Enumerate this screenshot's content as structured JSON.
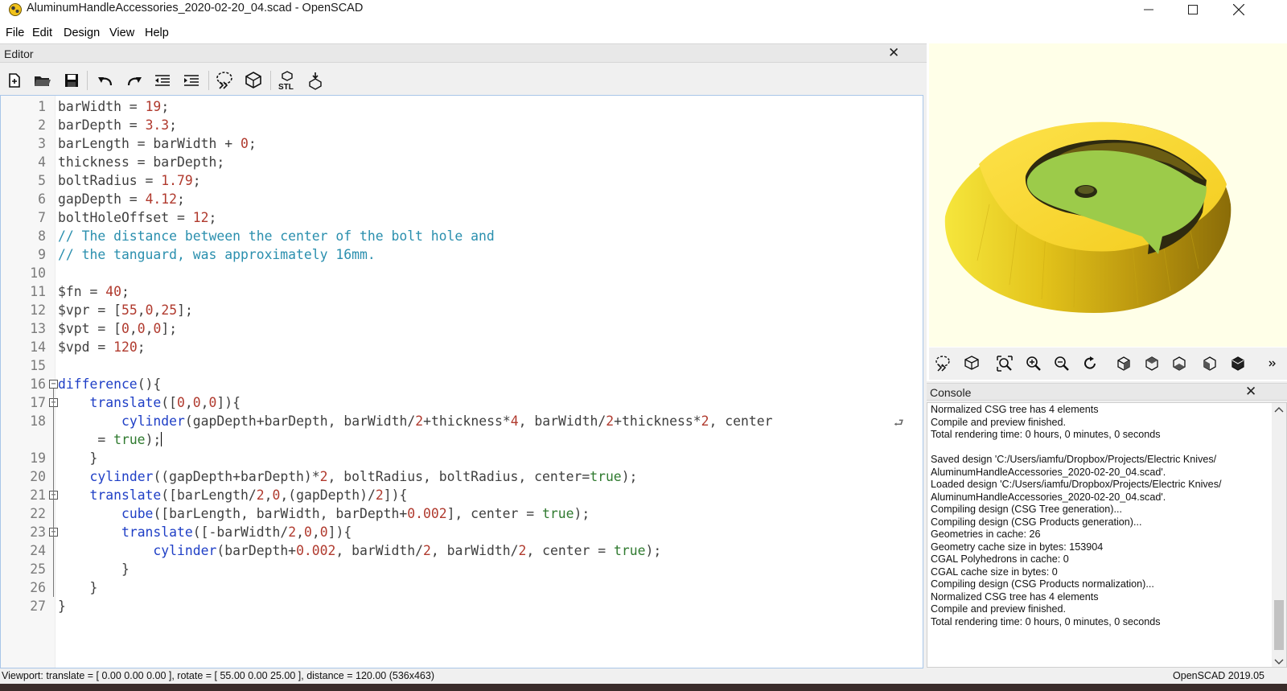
{
  "window": {
    "title": "AluminumHandleAccessories_2020-02-20_04.scad - OpenSCAD"
  },
  "menu": {
    "items": [
      "File",
      "Edit",
      "Design",
      "View",
      "Help"
    ]
  },
  "editor": {
    "title": "Editor",
    "close_label": "✕",
    "toolbar": [
      "new-icon",
      "open-icon",
      "save-icon",
      "undo-icon",
      "redo-icon",
      "unindent-icon",
      "indent-icon",
      "preview-icon",
      "render-icon",
      "export-stl-icon",
      "send-to-print-icon"
    ],
    "lines": [
      {
        "n": "1",
        "text": "barWidth = 19;"
      },
      {
        "n": "2",
        "text": "barDepth = 3.3;"
      },
      {
        "n": "3",
        "text": "barLength = barWidth + 0;"
      },
      {
        "n": "4",
        "text": "thickness = barDepth;"
      },
      {
        "n": "5",
        "text": "boltRadius = 1.79;"
      },
      {
        "n": "6",
        "text": "gapDepth = 4.12;"
      },
      {
        "n": "7",
        "text": "boltHoleOffset = 12;"
      },
      {
        "n": "8",
        "text": "// The distance between the center of the bolt hole and"
      },
      {
        "n": "9",
        "text": "// the tanguard, was approximately 16mm."
      },
      {
        "n": "10",
        "text": ""
      },
      {
        "n": "11",
        "text": "$fn = 40;"
      },
      {
        "n": "12",
        "text": "$vpr = [55,0,25];"
      },
      {
        "n": "13",
        "text": "$vpt = [0,0,0];"
      },
      {
        "n": "14",
        "text": "$vpd = 120;"
      },
      {
        "n": "15",
        "text": ""
      },
      {
        "n": "16",
        "text": "difference(){"
      },
      {
        "n": "17",
        "text": "    translate([0,0,0]){"
      },
      {
        "n": "18",
        "text": "        cylinder(gapDepth+barDepth, barWidth/2+thickness*4, barWidth/2+thickness*2, center"
      },
      {
        "n": "",
        "text": "     = true);"
      },
      {
        "n": "19",
        "text": "    }"
      },
      {
        "n": "20",
        "text": "    cylinder((gapDepth+barDepth)*2, boltRadius, boltRadius, center=true);"
      },
      {
        "n": "21",
        "text": "    translate([barLength/2,0,(gapDepth)/2]){"
      },
      {
        "n": "22",
        "text": "        cube([barLength, barWidth, barDepth+0.002], center = true);"
      },
      {
        "n": "23",
        "text": "        translate([-barWidth/2,0,0]){"
      },
      {
        "n": "24",
        "text": "            cylinder(barDepth+0.002, barWidth/2, barWidth/2, center = true);"
      },
      {
        "n": "25",
        "text": "        }"
      },
      {
        "n": "26",
        "text": "    }"
      },
      {
        "n": "27",
        "text": "}"
      }
    ]
  },
  "view_toolbar": [
    "preview-icon",
    "render-icon",
    "view-all-icon",
    "zoom-in-icon",
    "zoom-out-icon",
    "reset-view-icon",
    "view-right-icon",
    "view-top-icon",
    "view-bottom-icon",
    "view-left-icon",
    "view-front-icon",
    "more-icon"
  ],
  "console": {
    "title": "Console",
    "close_label": "✕",
    "lines": [
      "Normalized CSG tree has 4 elements",
      "Compile and preview finished.",
      "Total rendering time: 0 hours, 0 minutes, 0 seconds",
      "",
      "Saved design 'C:/Users/iamfu/Dropbox/Projects/Electric Knives/",
      "AluminumHandleAccessories_2020-02-20_04.scad'.",
      "Loaded design 'C:/Users/iamfu/Dropbox/Projects/Electric Knives/",
      "AluminumHandleAccessories_2020-02-20_04.scad'.",
      "Compiling design (CSG Tree generation)...",
      "Compiling design (CSG Products generation)...",
      "Geometries in cache: 26",
      "Geometry cache size in bytes: 153904",
      "CGAL Polyhedrons in cache: 0",
      "CGAL cache size in bytes: 0",
      "Compiling design (CSG Products normalization)...",
      "Normalized CSG tree has 4 elements",
      "Compile and preview finished.",
      "Total rendering time: 0 hours, 0 minutes, 0 seconds"
    ]
  },
  "status": {
    "viewport": "Viewport: translate = [ 0.00 0.00 0.00 ], rotate = [ 55.00 0.00 25.00 ], distance = 120.00 (536x463)",
    "version": "OpenSCAD 2019.05"
  },
  "colors": {
    "object_yellow": "#f8d81c",
    "cut_green": "#9ccb4a",
    "viewport_bg": "#ffffe8"
  }
}
